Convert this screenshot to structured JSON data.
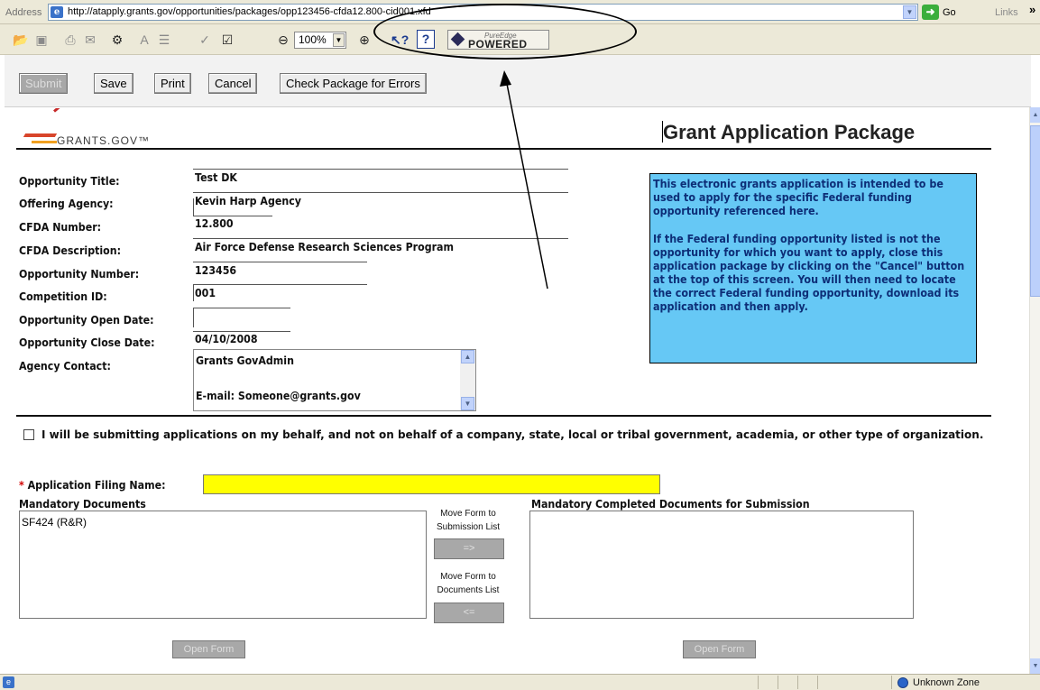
{
  "browser": {
    "address_label": "Address",
    "url": "http://atapply.grants.gov/opportunities/packages/opp123456-cfda12.800-cid001.xfd",
    "go_label": "Go",
    "links_label": "Links",
    "links_more": "»",
    "status_zone": "Unknown Zone"
  },
  "toolbar": {
    "zoom_value": "100%",
    "help_icon": "?",
    "logo_top": "PureEdge",
    "logo_bottom": "POWERED"
  },
  "form_buttons": {
    "submit": "Submit",
    "save": "Save",
    "print": "Print",
    "cancel": "Cancel",
    "check": "Check Package for Errors"
  },
  "header": {
    "logo_text": "GRANTS.GOV™",
    "title": "Grant Application Package"
  },
  "fields": {
    "opportunity_title": {
      "label": "Opportunity Title:",
      "value": "Test DK"
    },
    "offering_agency": {
      "label": "Offering Agency:",
      "value": "Kevin Harp Agency"
    },
    "cfda_number": {
      "label": "CFDA Number:",
      "value": "12.800"
    },
    "cfda_description": {
      "label": "CFDA Description:",
      "value": "Air Force Defense Research Sciences Program"
    },
    "opportunity_number": {
      "label": "Opportunity Number:",
      "value": "123456"
    },
    "competition_id": {
      "label": "Competition ID:",
      "value": "001"
    },
    "open_date": {
      "label": "Opportunity Open Date:",
      "value": ""
    },
    "close_date": {
      "label": "Opportunity Close Date:",
      "value": "04/10/2008"
    },
    "agency_contact": {
      "label": "Agency Contact:",
      "line1": "Grants GovAdmin",
      "line2": "E-mail: Someone@grants.gov"
    }
  },
  "notice": {
    "para1": "This electronic grants application is intended to be used to apply for the specific Federal funding opportunity referenced here.",
    "para2": "If the Federal funding opportunity listed is not the opportunity for which you want to apply, close this application package by clicking on the \"Cancel\" button at the top of this screen. You will then need to locate the correct Federal funding opportunity, download its application and then apply."
  },
  "individual_checkbox": {
    "label": "I will be submitting applications on my behalf, and not on behalf of a company, state, local or tribal government, academia, or other type of organization.",
    "checked": false
  },
  "filing": {
    "required_mark": "*",
    "label": "Application Filing Name:",
    "value": ""
  },
  "documents": {
    "mandatory_label": "Mandatory Documents",
    "mandatory_items": [
      "SF424 (R&R)"
    ],
    "completed_label": "Mandatory Completed Documents for Submission",
    "completed_items": [],
    "move_to_submission_label": "Move Form to Submission List",
    "move_to_documents_label": "Move Form to Documents List",
    "move_right_btn": "=>",
    "move_left_btn": "<=",
    "open_form_left": "Open Form",
    "open_form_right": "Open Form"
  },
  "colors": {
    "notice_bg": "#66c8f5",
    "notice_text": "#0d2e77",
    "filing_input_bg": "#ffff00",
    "disabled_button": "#a8a8a8"
  }
}
